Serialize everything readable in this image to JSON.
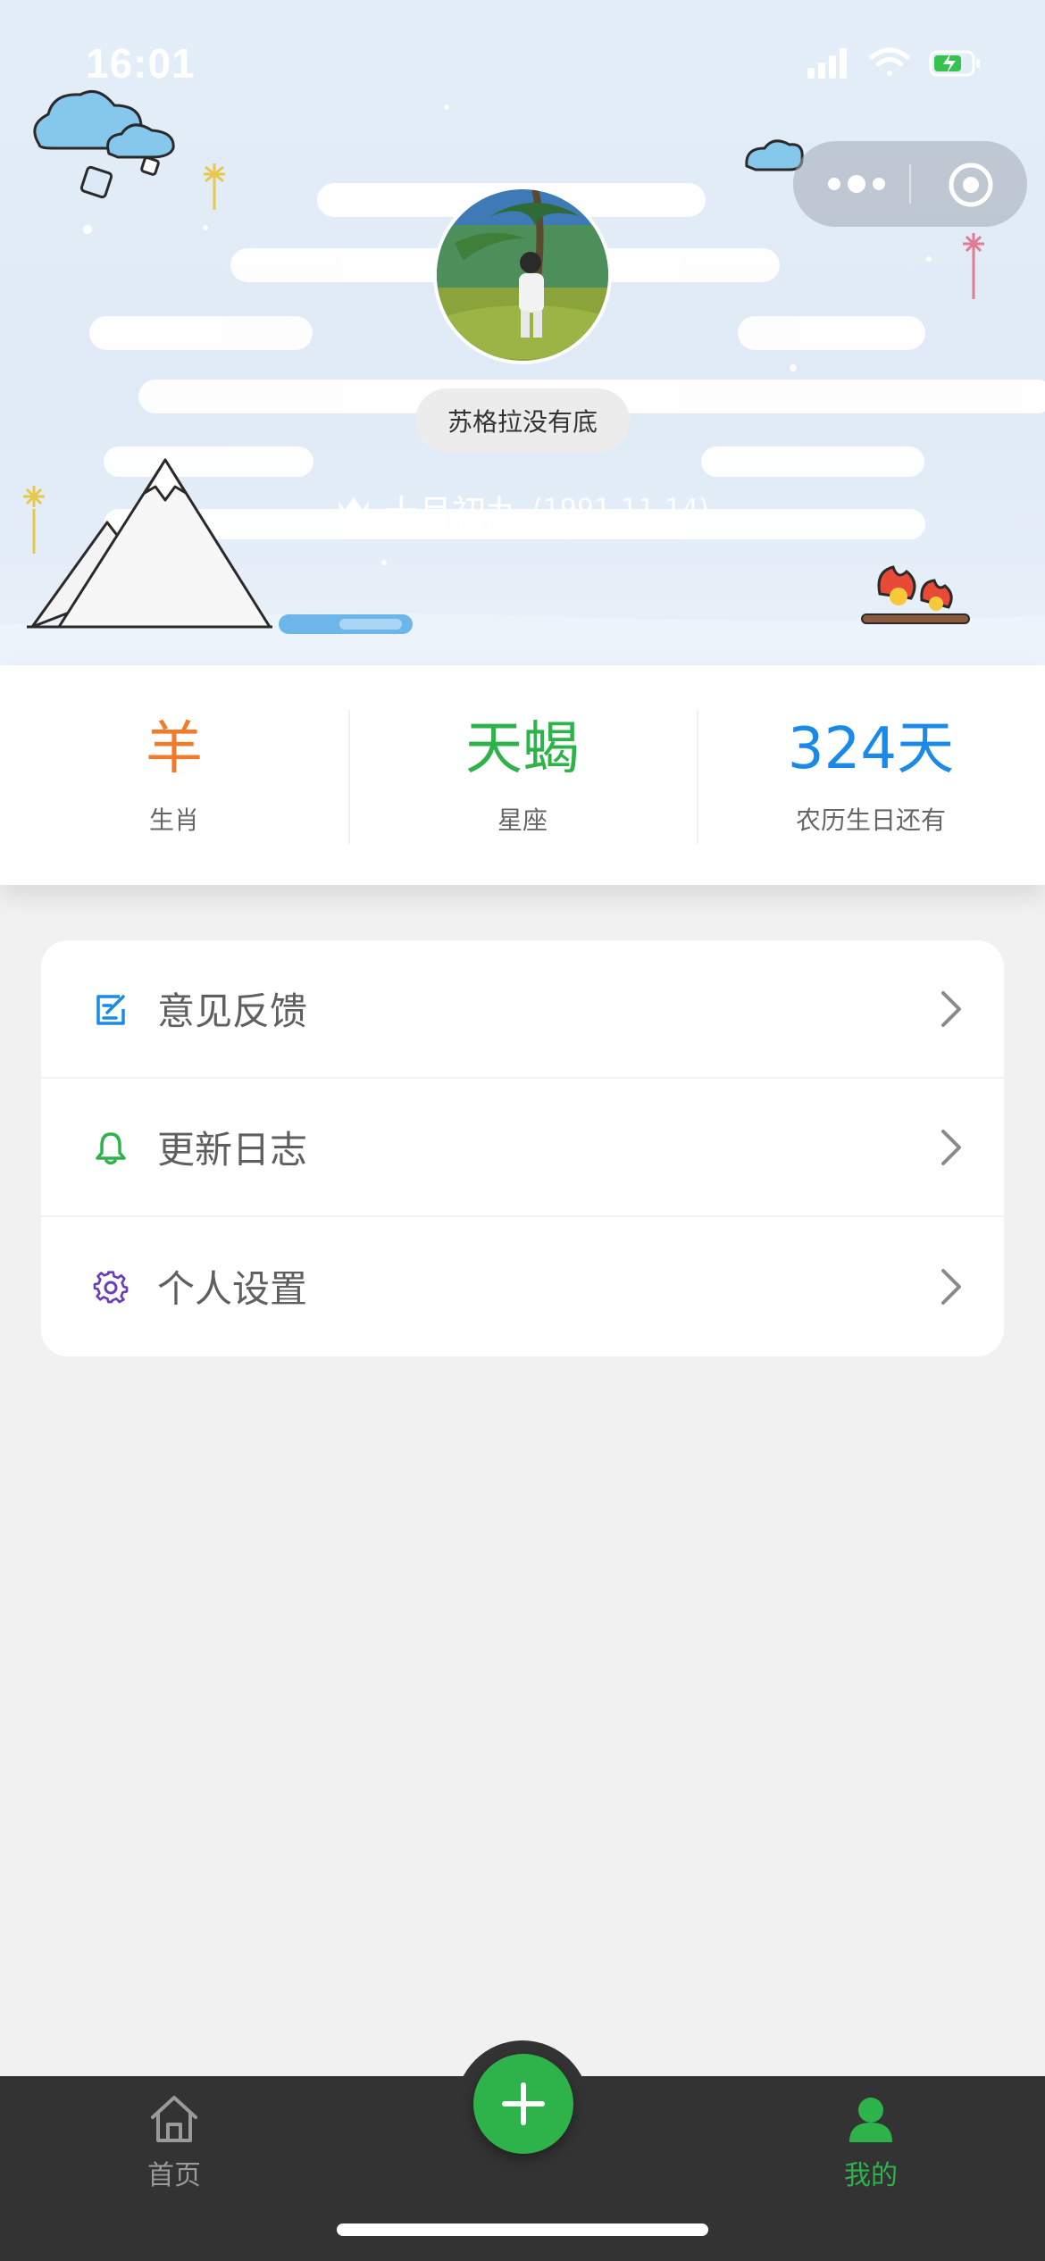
{
  "status_bar": {
    "time": "16:01"
  },
  "profile": {
    "nickname": "苏格拉没有底",
    "lunar_birthday": "十月初九",
    "solar_birthday": "(1991-11-14)"
  },
  "stats": [
    {
      "value": "羊",
      "label": "生肖",
      "color": "#f07b2a"
    },
    {
      "value": "天蝎",
      "label": "星座",
      "color": "#2eb24a"
    },
    {
      "value": "324天",
      "label": "农历生日还有",
      "color": "#1a8ae8"
    }
  ],
  "menu": {
    "items": [
      {
        "label": "意见反馈",
        "icon": "edit-icon",
        "icon_color": "#1a8ae8"
      },
      {
        "label": "更新日志",
        "icon": "bell-icon",
        "icon_color": "#2eb24a"
      },
      {
        "label": "个人设置",
        "icon": "gear-icon",
        "icon_color": "#6a3fb5"
      }
    ]
  },
  "tabbar": {
    "home_label": "首页",
    "mine_label": "我的",
    "active": "mine",
    "accent_color": "#2eb24a"
  }
}
